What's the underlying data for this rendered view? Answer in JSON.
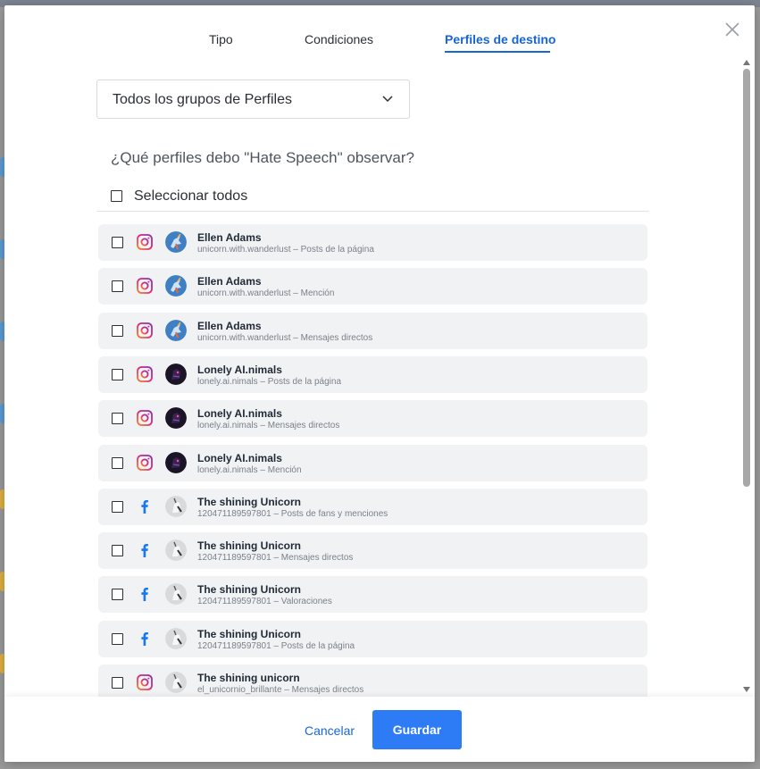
{
  "tabs": [
    {
      "label": "Tipo"
    },
    {
      "label": "Condiciones"
    },
    {
      "label": "Perfiles de destino"
    }
  ],
  "dropdown": {
    "selected": "Todos los grupos de Perfiles"
  },
  "question": "¿Qué perfiles debo \"Hate Speech\" observar?",
  "select_all": {
    "label": "Seleccionar todos"
  },
  "profiles": [
    {
      "platform": "instagram-icon",
      "name": "Ellen Adams",
      "sub": "unicorn.with.wanderlust – Posts de la página",
      "avatar": "unicorn-blue"
    },
    {
      "platform": "instagram-icon",
      "name": "Ellen Adams",
      "sub": "unicorn.with.wanderlust – Mención",
      "avatar": "unicorn-blue"
    },
    {
      "platform": "instagram-icon",
      "name": "Ellen Adams",
      "sub": "unicorn.with.wanderlust – Mensajes directos",
      "avatar": "unicorn-blue"
    },
    {
      "platform": "instagram-icon",
      "name": "Lonely AI.nimals",
      "sub": "lonely.ai.nimals – Posts de la página",
      "avatar": "dark-animal"
    },
    {
      "platform": "instagram-icon",
      "name": "Lonely AI.nimals",
      "sub": "lonely.ai.nimals – Mensajes directos",
      "avatar": "dark-animal"
    },
    {
      "platform": "instagram-icon",
      "name": "Lonely AI.nimals",
      "sub": "lonely.ai.nimals – Mención",
      "avatar": "dark-animal"
    },
    {
      "platform": "facebook-icon",
      "name": "The shining Unicorn",
      "sub": "120471189597801 – Posts de fans y menciones",
      "avatar": "unicorn-white"
    },
    {
      "platform": "facebook-icon",
      "name": "The shining Unicorn",
      "sub": "120471189597801 – Mensajes directos",
      "avatar": "unicorn-white"
    },
    {
      "platform": "facebook-icon",
      "name": "The shining Unicorn",
      "sub": "120471189597801 – Valoraciones",
      "avatar": "unicorn-white"
    },
    {
      "platform": "facebook-icon",
      "name": "The shining Unicorn",
      "sub": "120471189597801 – Posts de la página",
      "avatar": "unicorn-white"
    },
    {
      "platform": "instagram-icon",
      "name": "The shining unicorn",
      "sub": "el_unicornio_brillante – Mensajes directos",
      "avatar": "unicorn-white"
    }
  ],
  "footer": {
    "cancel_label": "Cancelar",
    "save_label": "Guardar"
  },
  "colors": {
    "accent": "#1766d4",
    "primary_button": "#2d7cf6",
    "instagram": "#d6249f",
    "facebook": "#1877f2"
  }
}
